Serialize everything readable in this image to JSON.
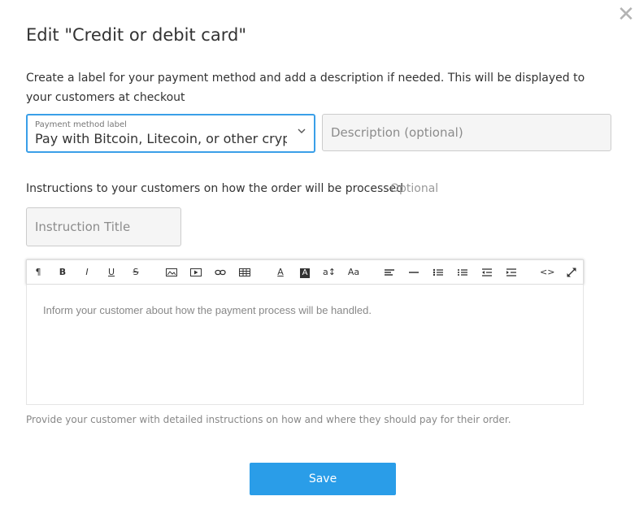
{
  "dialog": {
    "title": "Edit \"Credit or debit card\"",
    "close_icon": "close-icon",
    "intro": "Create a label for your payment method and add a description if needed. This will be displayed to your customers at checkout"
  },
  "payment_method": {
    "label": "Payment method label",
    "value": "Pay with Bitcoin, Litecoin, or other cryptocurrency",
    "accent": "#3a9fe8"
  },
  "description": {
    "placeholder": "Description (optional)"
  },
  "instructions": {
    "label": "Instructions to your customers on how the order will be processed",
    "optional": "Optional",
    "title_placeholder": "Instruction Title",
    "editor_placeholder": "Inform your customer about how the payment process will be handled.",
    "help": "Provide your customer with detailed instructions on how and where they should pay for their order."
  },
  "toolbar": {
    "paragraph": "¶",
    "bold": "B",
    "italic": "I",
    "underline": "U",
    "strike": "S",
    "text_color": "A",
    "bg_color": "A",
    "font_size": "a↕",
    "font_family": "Aa",
    "code": "<>"
  },
  "save_button": {
    "label": "Save",
    "color": "#2a9de8"
  }
}
